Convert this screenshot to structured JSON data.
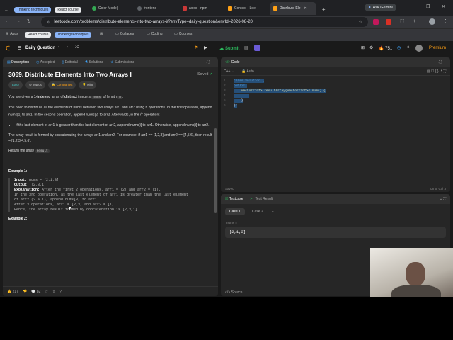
{
  "browser": {
    "tabs": [
      {
        "label": "Thinking techniques",
        "kind": "group",
        "color": "#8ab4f8"
      },
      {
        "label": "React course",
        "kind": "group",
        "color": "#e8eaed"
      },
      {
        "label": "Color Mode |",
        "color": "#34a853"
      },
      {
        "label": "frontend",
        "color": "#5f6368"
      },
      {
        "label": "axios - npm",
        "color": "#cb3837"
      },
      {
        "label": "Contest - Lee",
        "color": "#ffa116"
      },
      {
        "label": "Distribute Ele",
        "color": "#ffa116",
        "active": true
      }
    ],
    "new_tab": "+",
    "ask_gemini": "Ask Gemini",
    "url": "leetcode.com/problems/distribute-elements-into-two-arrays-i/?envType=daily-question&envId=2026-08-20",
    "bookmarks": {
      "apps": "Apps",
      "group1": "React course",
      "group2": "Thinking techniques",
      "folders": [
        "Collages",
        "Coding",
        "Courses"
      ]
    }
  },
  "lc": {
    "daily_label": "Daily Question",
    "submit_label": "Submit",
    "streak": "751",
    "premium": "Premium"
  },
  "left": {
    "tabs": [
      "Description",
      "Accepted",
      "Editorial",
      "Solutions",
      "Submissions"
    ],
    "title": "3069. Distribute Elements Into Two Arrays I",
    "solved": "Solved",
    "tags": [
      "Easy",
      "Topics",
      "Companies",
      "Hint"
    ],
    "p1a": "You are given a ",
    "p1b": "1-indexed",
    "p1c": " array of ",
    "p1d": "distinct",
    "p1e": " integers ",
    "p1f": "nums",
    "p1g": " of length ",
    "p1h": "n",
    "p2": "You need to distribute all the elements of nums between two arrays arr1 and arr2 using n operations. In the first operation, append nums[1] to arr1. In the second operation, append nums[2] to arr2. Afterwards, in the i",
    "p2sup": "th",
    "p2end": " operation:",
    "bullet": "If the last element of arr1 is greater than the last element of arr2, append nums[i] to arr1. Otherwise, append nums[i] to arr2.",
    "p3": "The array result is formed by concatenating the arrays arr1 and arr2. For example, if arr1 == [1,2,3] and arr2 == [4,5,6], then result = [1,2,3,4,5,6].",
    "p4a": "Return the array ",
    "p4b": "result",
    "p4c": ".",
    "ex1_title": "Example 1:",
    "ex1_input_label": "Input:",
    "ex1_input": " nums = [2,1,3]",
    "ex1_output_label": "Output:",
    "ex1_output": " [2,3,1]",
    "ex1_expl_label": "Explanation:",
    "ex1_expl": " After the first 2 operations, arr1 = [2] and arr2 = [1].",
    "ex1_l2": "In the 3rd operation, as the last element of arr1 is greater than the last element",
    "ex1_l3": "of arr2 (2 > 1), append nums[3] to arr1.",
    "ex1_l4": "After 3 operations, arr1 = [2,3] and arr2 = [1].",
    "ex1_l5": "Hence, the array result formed by concatenation is [2,3,1].",
    "ex2_title": "Example 2:",
    "likes": "217",
    "comments": "82"
  },
  "code": {
    "tab": "Code",
    "lang": "C++",
    "auto": "Auto",
    "lines": [
      {
        "n": "1",
        "t": "class Solution {"
      },
      {
        "n": "2",
        "t": "public:"
      },
      {
        "n": "3",
        "t": "    vector<int> resultArray(vector<int>& nums) {"
      },
      {
        "n": "4",
        "t": "        "
      },
      {
        "n": "5",
        "t": "    }"
      },
      {
        "n": "6",
        "t": "};"
      }
    ],
    "saved": "Saved",
    "pos": "Ln 6, Col 3"
  },
  "testcase": {
    "tabs": [
      "Testcase",
      "Test Result"
    ],
    "cases": [
      "Case 1",
      "Case 2"
    ],
    "add": "+",
    "label": "nums =",
    "value": "[2,1,3]",
    "source": "Source"
  }
}
